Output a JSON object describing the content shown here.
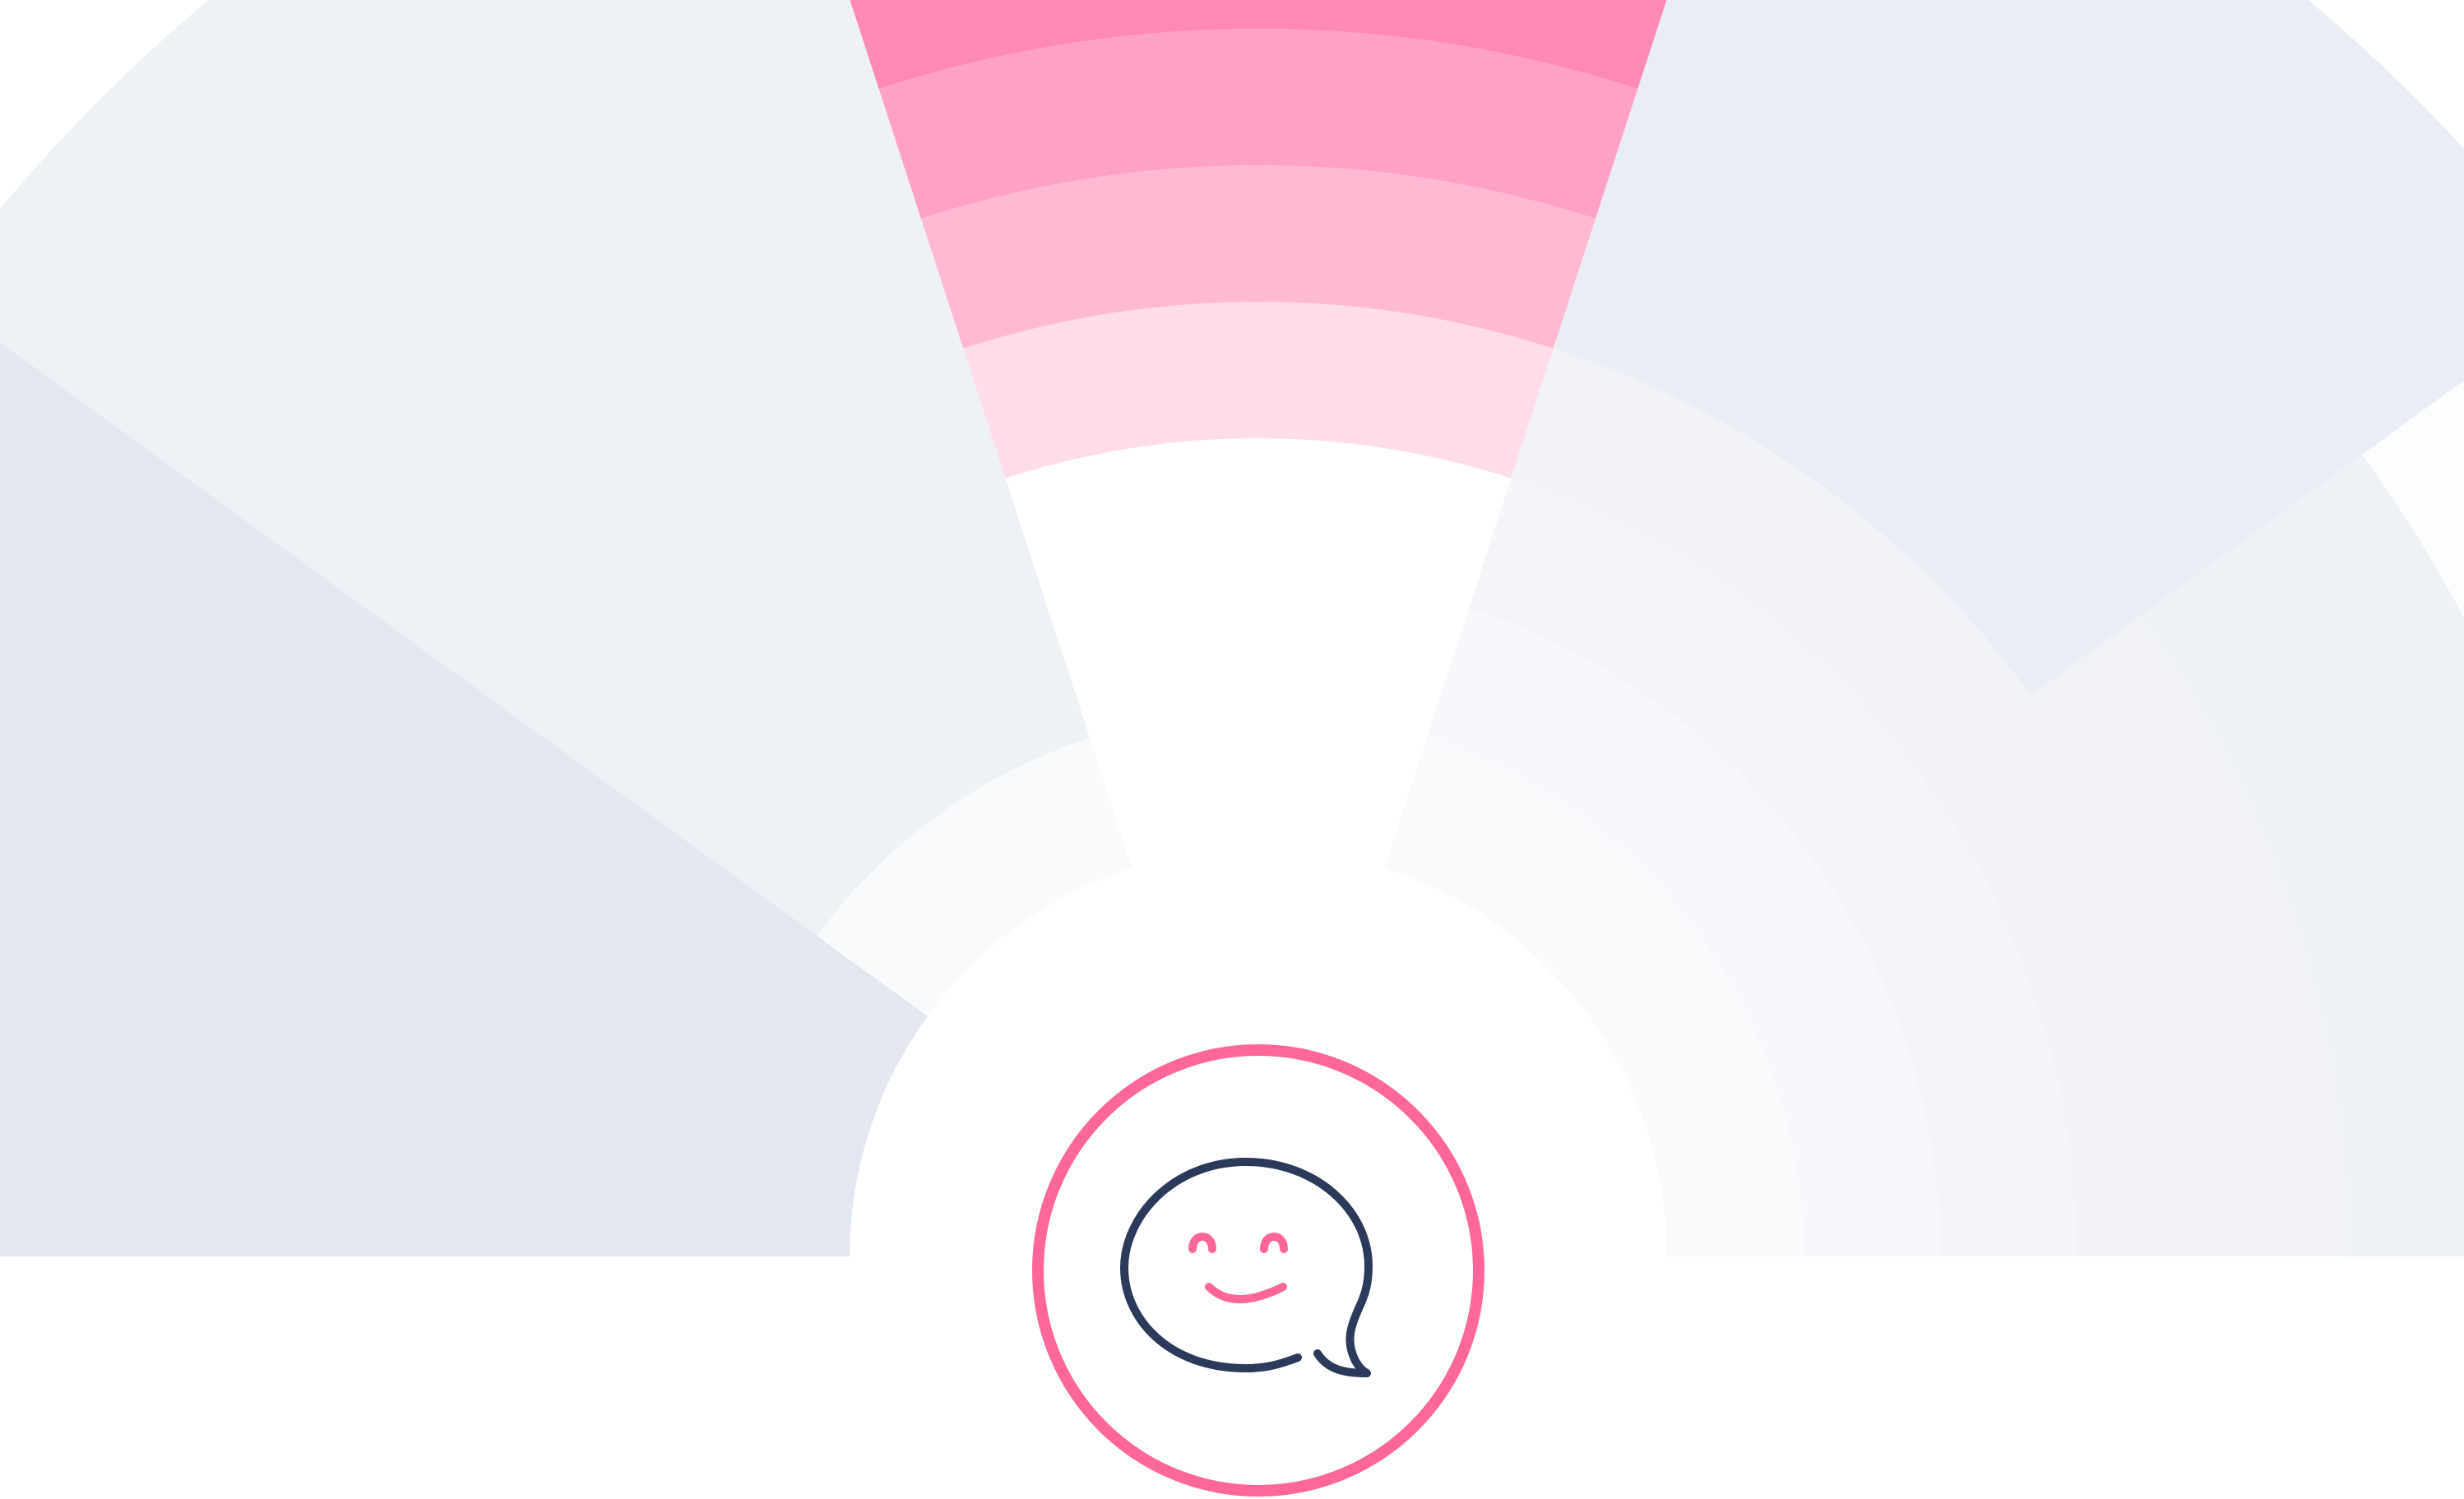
{
  "chart_data": {
    "type": "radial-bar",
    "levels": 9,
    "sectors": [
      {
        "value": 9,
        "color": "#e2e7f0"
      },
      {
        "value": 8,
        "color": "#eef1f6"
      },
      {
        "value": 8,
        "color": "#eef1f6"
      },
      {
        "value": 5,
        "color": "#e9edf5"
      },
      {
        "value": 2,
        "color": "#fdfdfe"
      }
    ],
    "highlight": {
      "sector": 2,
      "color": "#ff6fa2",
      "band_colors": [
        "#d4dbe9",
        "#ff6fa2",
        "#ff89b5",
        "#ffa1c5",
        "#ffb9d3",
        "#ffdce9"
      ]
    },
    "background_colors": [
      "#f9fafc",
      "#f7f8fb",
      "#f4f5f9",
      "#f1f3f7",
      "#f0f2f6",
      "#eef1f6",
      "#eef1f6",
      "#eef1f6",
      "#eef1f6"
    ]
  },
  "badge": {
    "icon": "smiling-chat-bubble-icon",
    "ring_color": "#ff6699",
    "outline_color": "#2b3a5a",
    "face_color": "#ff6699"
  }
}
